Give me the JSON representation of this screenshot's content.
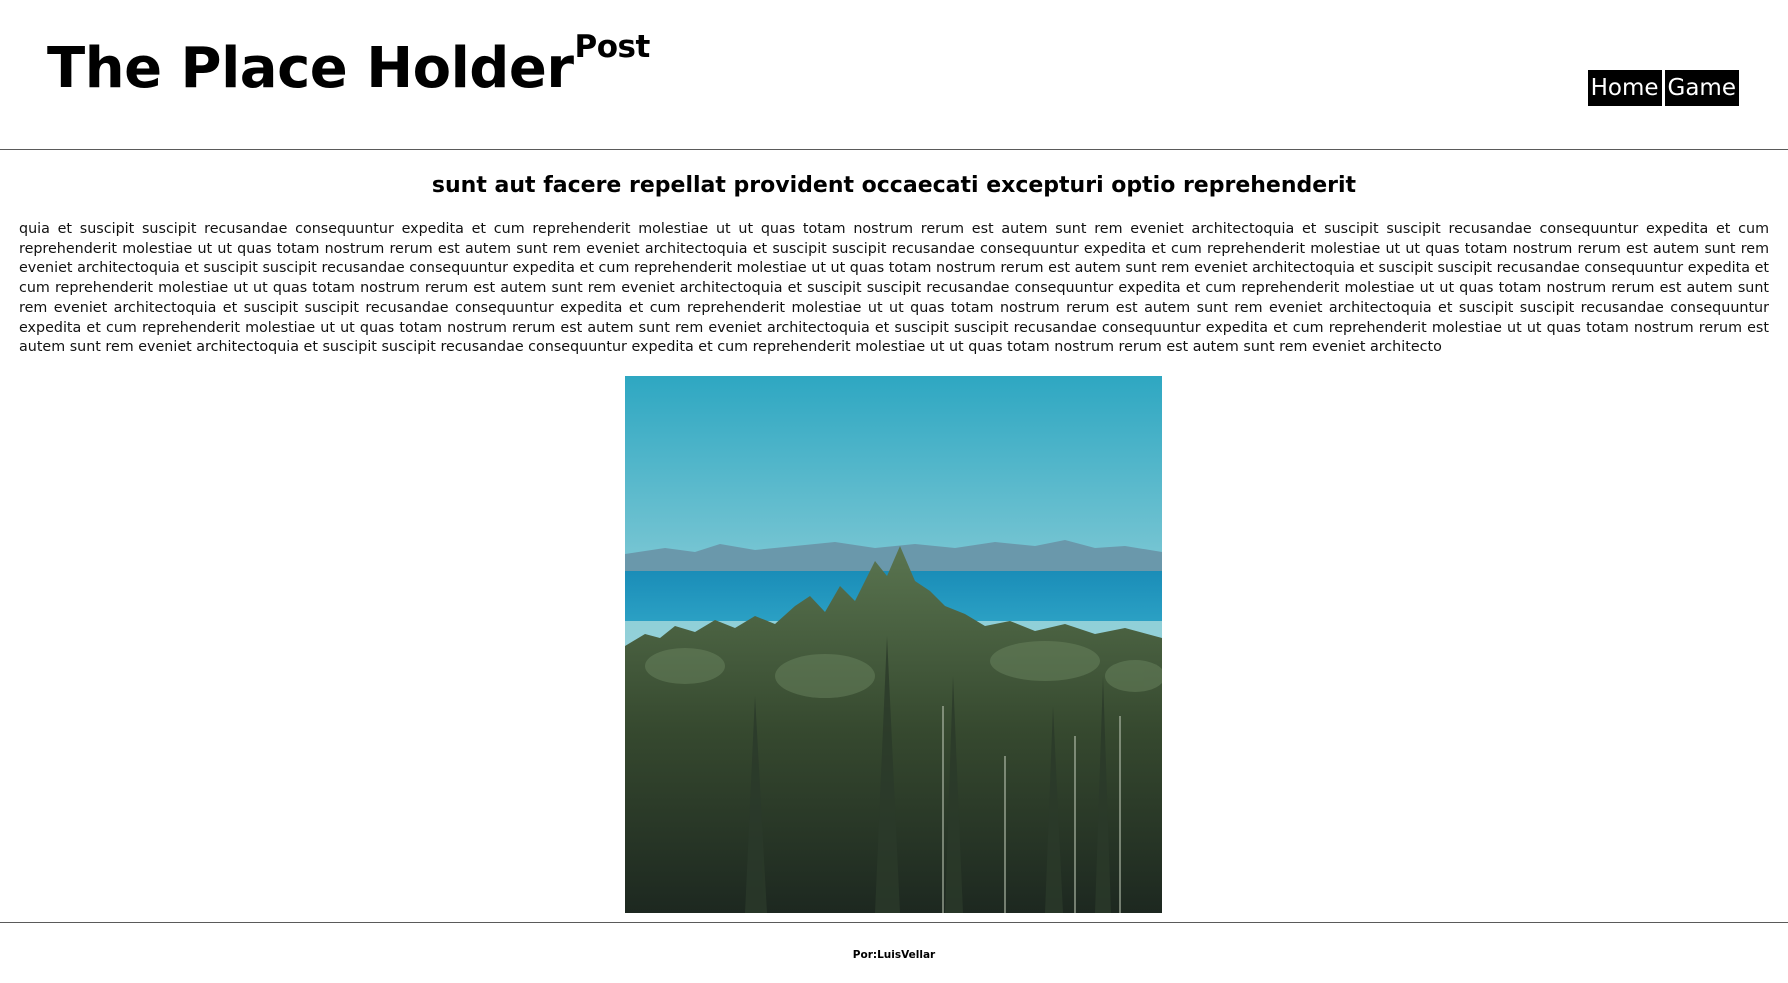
{
  "header": {
    "title": "The Place Holder",
    "title_sup": "Post",
    "nav": [
      {
        "label": "Home"
      },
      {
        "label": "Game"
      }
    ]
  },
  "post": {
    "title": "sunt aut facere repellat provident occaecati excepturi optio reprehenderit",
    "body": "quia et suscipit suscipit recusandae consequuntur expedita et cum reprehenderit molestiae ut ut quas totam nostrum rerum est autem sunt rem eveniet architectoquia et suscipit suscipit recusandae consequuntur expedita et cum reprehenderit molestiae ut ut quas totam nostrum rerum est autem sunt rem eveniet architectoquia et suscipit suscipit recusandae consequuntur expedita et cum reprehenderit molestiae ut ut quas totam nostrum rerum est autem sunt rem eveniet architectoquia et suscipit suscipit recusandae consequuntur expedita et cum reprehenderit molestiae ut ut quas totam nostrum rerum est autem sunt rem eveniet architectoquia et suscipit suscipit recusandae consequuntur expedita et cum reprehenderit molestiae ut ut quas totam nostrum rerum est autem sunt rem eveniet architectoquia et suscipit suscipit recusandae consequuntur expedita et cum reprehenderit molestiae ut ut quas totam nostrum rerum est autem sunt rem eveniet architectoquia et suscipit suscipit recusandae consequuntur expedita et cum reprehenderit molestiae ut ut quas totam nostrum rerum est autem sunt rem eveniet architectoquia et suscipit suscipit recusandae consequuntur expedita et cum reprehenderit molestiae ut ut quas totam nostrum rerum est autem sunt rem eveniet architectoquia et suscipit suscipit recusandae consequuntur expedita et cum reprehenderit molestiae ut ut quas totam nostrum rerum est autem sunt rem eveniet architectoquia et suscipit suscipit recusandae consequuntur expedita et cum reprehenderit molestiae ut ut quas totam nostrum rerum est autem sunt rem eveniet architecto",
    "image_subject": "forest-lake-landscape-photo"
  },
  "footer": {
    "credit": "Por:LuisVellar"
  },
  "colors": {
    "nav_bg": "#000000",
    "nav_text": "#ffffff",
    "divider": "#5a5a5a"
  }
}
